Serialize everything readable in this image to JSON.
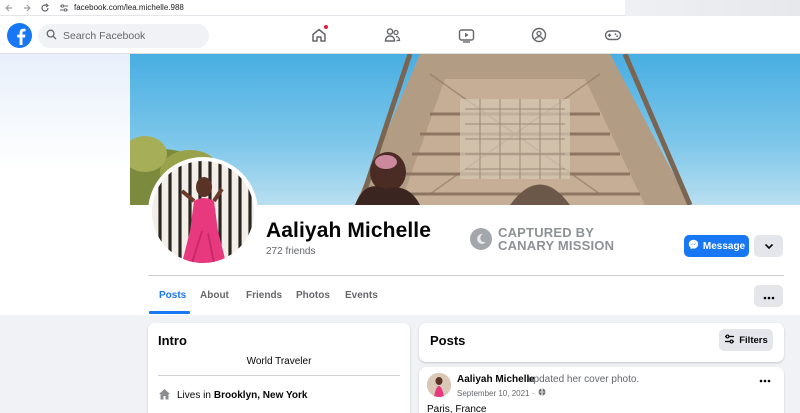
{
  "browser": {
    "url": "facebook.com/lea.michelle.988",
    "back_icon": "back-arrow-icon",
    "forward_icon": "forward-arrow-icon",
    "reload_icon": "reload-icon"
  },
  "topbar": {
    "logo": "facebook-logo-icon",
    "search_placeholder": "Search Facebook",
    "nav_icons": [
      "home-icon",
      "friends-icon",
      "watch-icon",
      "groups-icon",
      "gaming-icon"
    ],
    "home_has_notification": true
  },
  "profile": {
    "name": "Aaliyah Michelle",
    "friends": "272 friends",
    "watermark_line1": "CAPTURED BY",
    "watermark_line2": "CANARY MISSION",
    "message_label": "Message",
    "tabs": [
      "Posts",
      "About",
      "Friends",
      "Photos",
      "Events"
    ],
    "active_tab": "Posts"
  },
  "intro": {
    "title": "Intro",
    "bio": "World Traveler",
    "lives_prefix": "Lives in",
    "lives_location": "Brooklyn, New York"
  },
  "posts": {
    "title": "Posts",
    "filters_label": "Filters"
  },
  "post": {
    "author": "Aaliyah Michelle",
    "action": "updated her cover photo.",
    "date": "September 10, 2021 ·",
    "text": "Paris, France"
  },
  "colors": {
    "brand": "#1877f2",
    "badge": "#e41e3f",
    "background": "#f0f2f5"
  }
}
